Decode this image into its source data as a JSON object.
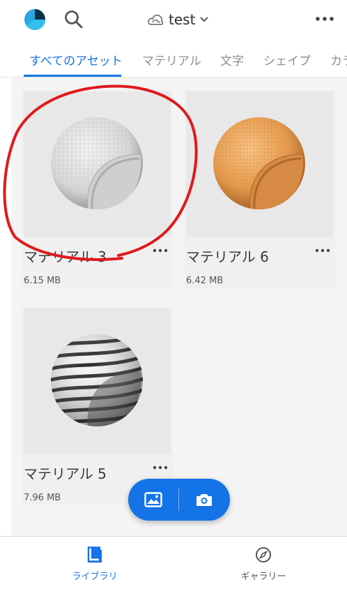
{
  "header": {
    "library_name": "test",
    "colors": {
      "accent": "#1473e6",
      "annotation": "#e0191b"
    }
  },
  "tabs": [
    {
      "label": "すべてのアセット",
      "active": true
    },
    {
      "label": "マテリアル",
      "active": false
    },
    {
      "label": "文字",
      "active": false
    },
    {
      "label": "シェイプ",
      "active": false
    },
    {
      "label": "カラ",
      "active": false
    }
  ],
  "assets": [
    {
      "name": "マテリアル 3",
      "size": "6.15 MB",
      "material": "white-fabric"
    },
    {
      "name": "マテリアル 6",
      "size": "6.42 MB",
      "material": "orange-leather"
    },
    {
      "name": "マテリアル 5",
      "size": "7.96 MB",
      "material": "black-white-stripes"
    }
  ],
  "bottom_nav": [
    {
      "label": "ライブラリ",
      "active": true,
      "icon": "library-icon"
    },
    {
      "label": "ギャラリー",
      "active": false,
      "icon": "compass-icon"
    }
  ],
  "fab": {
    "icons": [
      "image-icon",
      "camera-icon"
    ]
  }
}
